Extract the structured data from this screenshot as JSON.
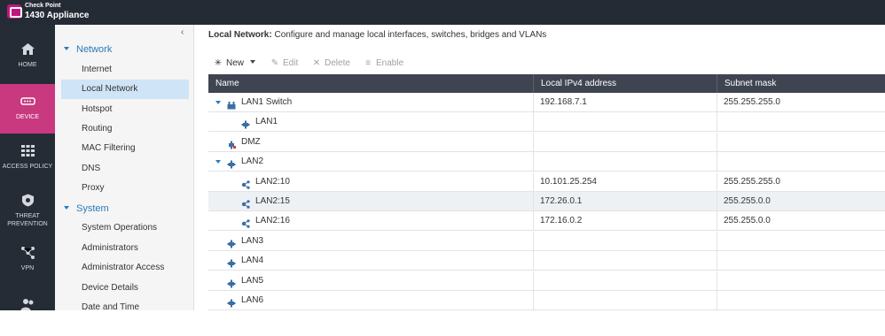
{
  "header": {
    "company": "Check Point",
    "model": "1430 Appliance"
  },
  "rail": {
    "items": [
      {
        "label": "HOME"
      },
      {
        "label": "DEVICE"
      },
      {
        "label": "ACCESS POLICY"
      },
      {
        "label": "THREAT PREVENTION"
      },
      {
        "label": "VPN"
      },
      {
        "label": ""
      }
    ]
  },
  "secnav": {
    "sections": [
      {
        "title": "Network",
        "items": [
          "Internet",
          "Local Network",
          "Hotspot",
          "Routing",
          "MAC Filtering",
          "DNS",
          "Proxy"
        ]
      },
      {
        "title": "System",
        "items": [
          "System Operations",
          "Administrators",
          "Administrator Access",
          "Device Details",
          "Date and Time"
        ]
      }
    ],
    "selected": "Local Network"
  },
  "main": {
    "crumb_title": "Local Network:",
    "crumb_desc": " Configure and manage local interfaces, switches, bridges and VLANs"
  },
  "toolbar": {
    "new": "New",
    "edit": "Edit",
    "delete": "Delete",
    "enable": "Enable"
  },
  "grid": {
    "columns": [
      "Name",
      "Local IPv4 address",
      "Subnet mask"
    ],
    "rows": [
      {
        "name": "LAN1 Switch",
        "ip": "192.168.7.1",
        "mask": "255.255.255.0",
        "level": 0,
        "expand": true,
        "icon": "switch-icon"
      },
      {
        "name": "LAN1",
        "ip": "",
        "mask": "",
        "level": 1,
        "expand": false,
        "icon": "port-icon"
      },
      {
        "name": "DMZ",
        "ip": "",
        "mask": "",
        "level": 0,
        "expand": false,
        "icon": "dmz-icon"
      },
      {
        "name": "LAN2",
        "ip": "",
        "mask": "",
        "level": 0,
        "expand": true,
        "icon": "port-icon"
      },
      {
        "name": "LAN2:10",
        "ip": "10.101.25.254",
        "mask": "255.255.255.0",
        "level": 1,
        "expand": false,
        "icon": "vlan-icon"
      },
      {
        "name": "LAN2:15",
        "ip": "172.26.0.1",
        "mask": "255.255.0.0",
        "level": 1,
        "expand": false,
        "icon": "vlan-icon",
        "highlight": true
      },
      {
        "name": "LAN2:16",
        "ip": "172.16.0.2",
        "mask": "255.255.0.0",
        "level": 1,
        "expand": false,
        "icon": "vlan-icon"
      },
      {
        "name": "LAN3",
        "ip": "",
        "mask": "",
        "level": 0,
        "expand": false,
        "icon": "port-icon"
      },
      {
        "name": "LAN4",
        "ip": "",
        "mask": "",
        "level": 0,
        "expand": false,
        "icon": "port-icon"
      },
      {
        "name": "LAN5",
        "ip": "",
        "mask": "",
        "level": 0,
        "expand": false,
        "icon": "port-icon"
      },
      {
        "name": "LAN6",
        "ip": "",
        "mask": "",
        "level": 0,
        "expand": false,
        "icon": "port-icon"
      }
    ]
  },
  "colors": {
    "accent": "#2a7ab9",
    "active_rail": "#c8397f",
    "header_bg": "#252b35",
    "grid_head": "#3e4551",
    "selected": "#cfe4f6"
  }
}
